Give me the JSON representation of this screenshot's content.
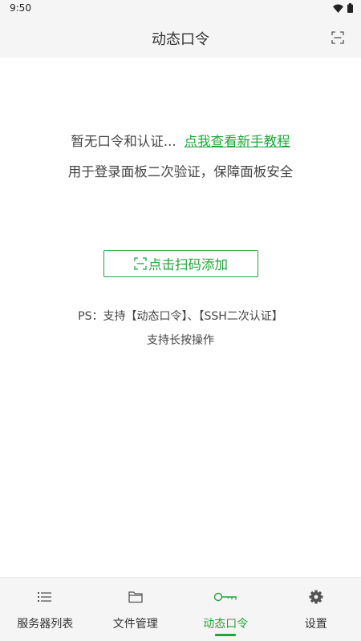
{
  "status_bar": {
    "time": "9:50",
    "icons": [
      "wifi-icon",
      "battery-icon"
    ]
  },
  "app_bar": {
    "title": "动态口令",
    "action_icon": "scan-icon"
  },
  "empty_state": {
    "line1": "暂无口令和认证...",
    "guide_link": "点我查看新手教程",
    "line2": "用于登录面板二次验证，保障面板安全"
  },
  "add_button": {
    "icon": "scan-icon",
    "label": "点击扫码添加"
  },
  "tips": {
    "line1": "PS：支持【动态口令】、【SSH二次认证】",
    "line2": "支持长按操作"
  },
  "bottom_nav": {
    "items": [
      {
        "label": "服务器列表",
        "icon": "list-icon",
        "active": false
      },
      {
        "label": "文件管理",
        "icon": "folder-icon",
        "active": false
      },
      {
        "label": "动态口令",
        "icon": "key-icon",
        "active": true
      },
      {
        "label": "设置",
        "icon": "gear-icon",
        "active": false
      }
    ]
  },
  "colors": {
    "accent": "#20a53a",
    "bar_background": "#f5f5f5",
    "text": "#333333"
  }
}
